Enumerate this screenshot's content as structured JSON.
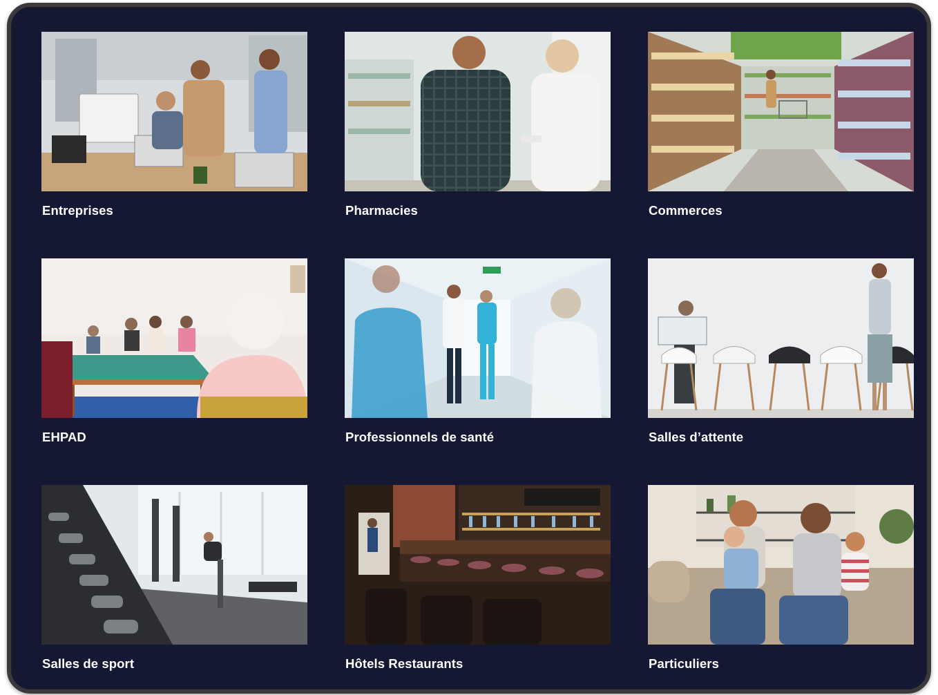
{
  "categories": [
    {
      "label": "Entreprises",
      "image": "office-team-photo"
    },
    {
      "label": "Pharmacies",
      "image": "pharmacy-photo"
    },
    {
      "label": "Commerces",
      "image": "supermarket-aisle-photo"
    },
    {
      "label": "EHPAD",
      "image": "nursing-home-photo"
    },
    {
      "label": "Professionnels de santé",
      "image": "hospital-corridor-photo"
    },
    {
      "label": "Salles d’attente",
      "image": "waiting-room-photo"
    },
    {
      "label": "Salles de sport",
      "image": "gym-photo"
    },
    {
      "label": "Hôtels Restaurants",
      "image": "bar-restaurant-photo"
    },
    {
      "label": "Particuliers",
      "image": "family-sofa-photo"
    }
  ],
  "colors": {
    "background": "#141833",
    "frame_border": "#3a3a3e",
    "caption_text": "#ffffff"
  }
}
